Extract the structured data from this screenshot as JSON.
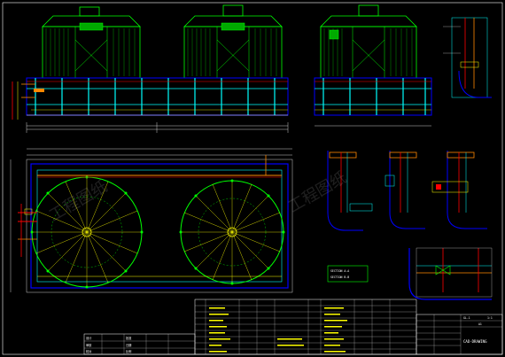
{
  "drawing": {
    "title_block": {
      "drawing_name": "CAD-DRAWING",
      "label_left": "GL-1",
      "label_right": "1:1",
      "small_labels": [
        "设计",
        "审核",
        "校对",
        "批准",
        "日期",
        "比例"
      ]
    },
    "legend_box": {
      "line1": "SECTION A-A",
      "line2": "SECTION B-B"
    },
    "sheet_corner_label": "A1",
    "watermark_text": "工程图纸"
  },
  "colors": {
    "background": "#000000",
    "green": "#00ff00",
    "cyan": "#00ffff",
    "blue": "#0000ff",
    "red": "#ff0000",
    "yellow": "#ffff00",
    "white": "#ffffff",
    "orange": "#ff8000",
    "magenta": "#ff00ff"
  }
}
